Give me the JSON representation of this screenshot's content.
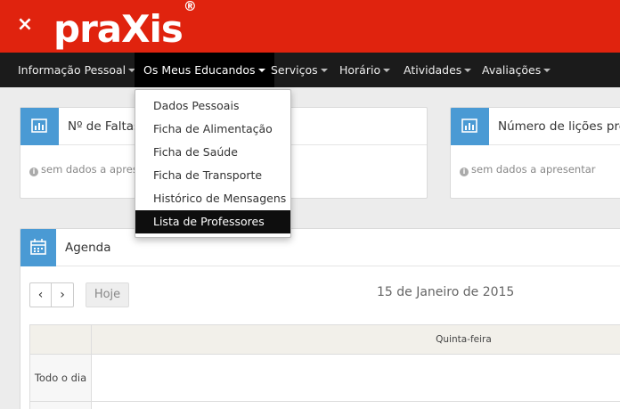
{
  "header": {
    "logo_text": "praXis",
    "logo_mark": "®",
    "close_icon": "×",
    "brand_color": "#e0230e"
  },
  "nav": {
    "items": [
      {
        "label": "Informação Pessoal"
      },
      {
        "label": "Os Meus Educandos"
      },
      {
        "label": "Serviços"
      },
      {
        "label": "Horário"
      },
      {
        "label": "Atividades"
      },
      {
        "label": "Avaliações"
      }
    ]
  },
  "dropdown": {
    "items": [
      {
        "label": "Dados Pessoais"
      },
      {
        "label": "Ficha de Alimentação"
      },
      {
        "label": "Ficha de Saúde"
      },
      {
        "label": "Ficha de Transporte"
      },
      {
        "label": "Histórico de Mensagens"
      },
      {
        "label": "Lista de Professores"
      }
    ]
  },
  "panels": {
    "faltas": {
      "title": "Nº de Faltas",
      "empty": "sem dados a apresentar",
      "icon": "bar-chart-icon"
    },
    "licoes": {
      "title": "Número de lições previstas",
      "empty": "sem dados a apresentar",
      "icon": "bar-chart-icon"
    }
  },
  "agenda": {
    "title": "Agenda",
    "icon": "calendar-icon",
    "prev": "‹",
    "next": "›",
    "today": "Hoje",
    "date": "15 de Janeiro de 2015",
    "day_header": "Quinta-feira",
    "all_day": "Todo o dia"
  },
  "colors": {
    "accent": "#4a9ad4",
    "navbar": "#1b1b1b"
  }
}
